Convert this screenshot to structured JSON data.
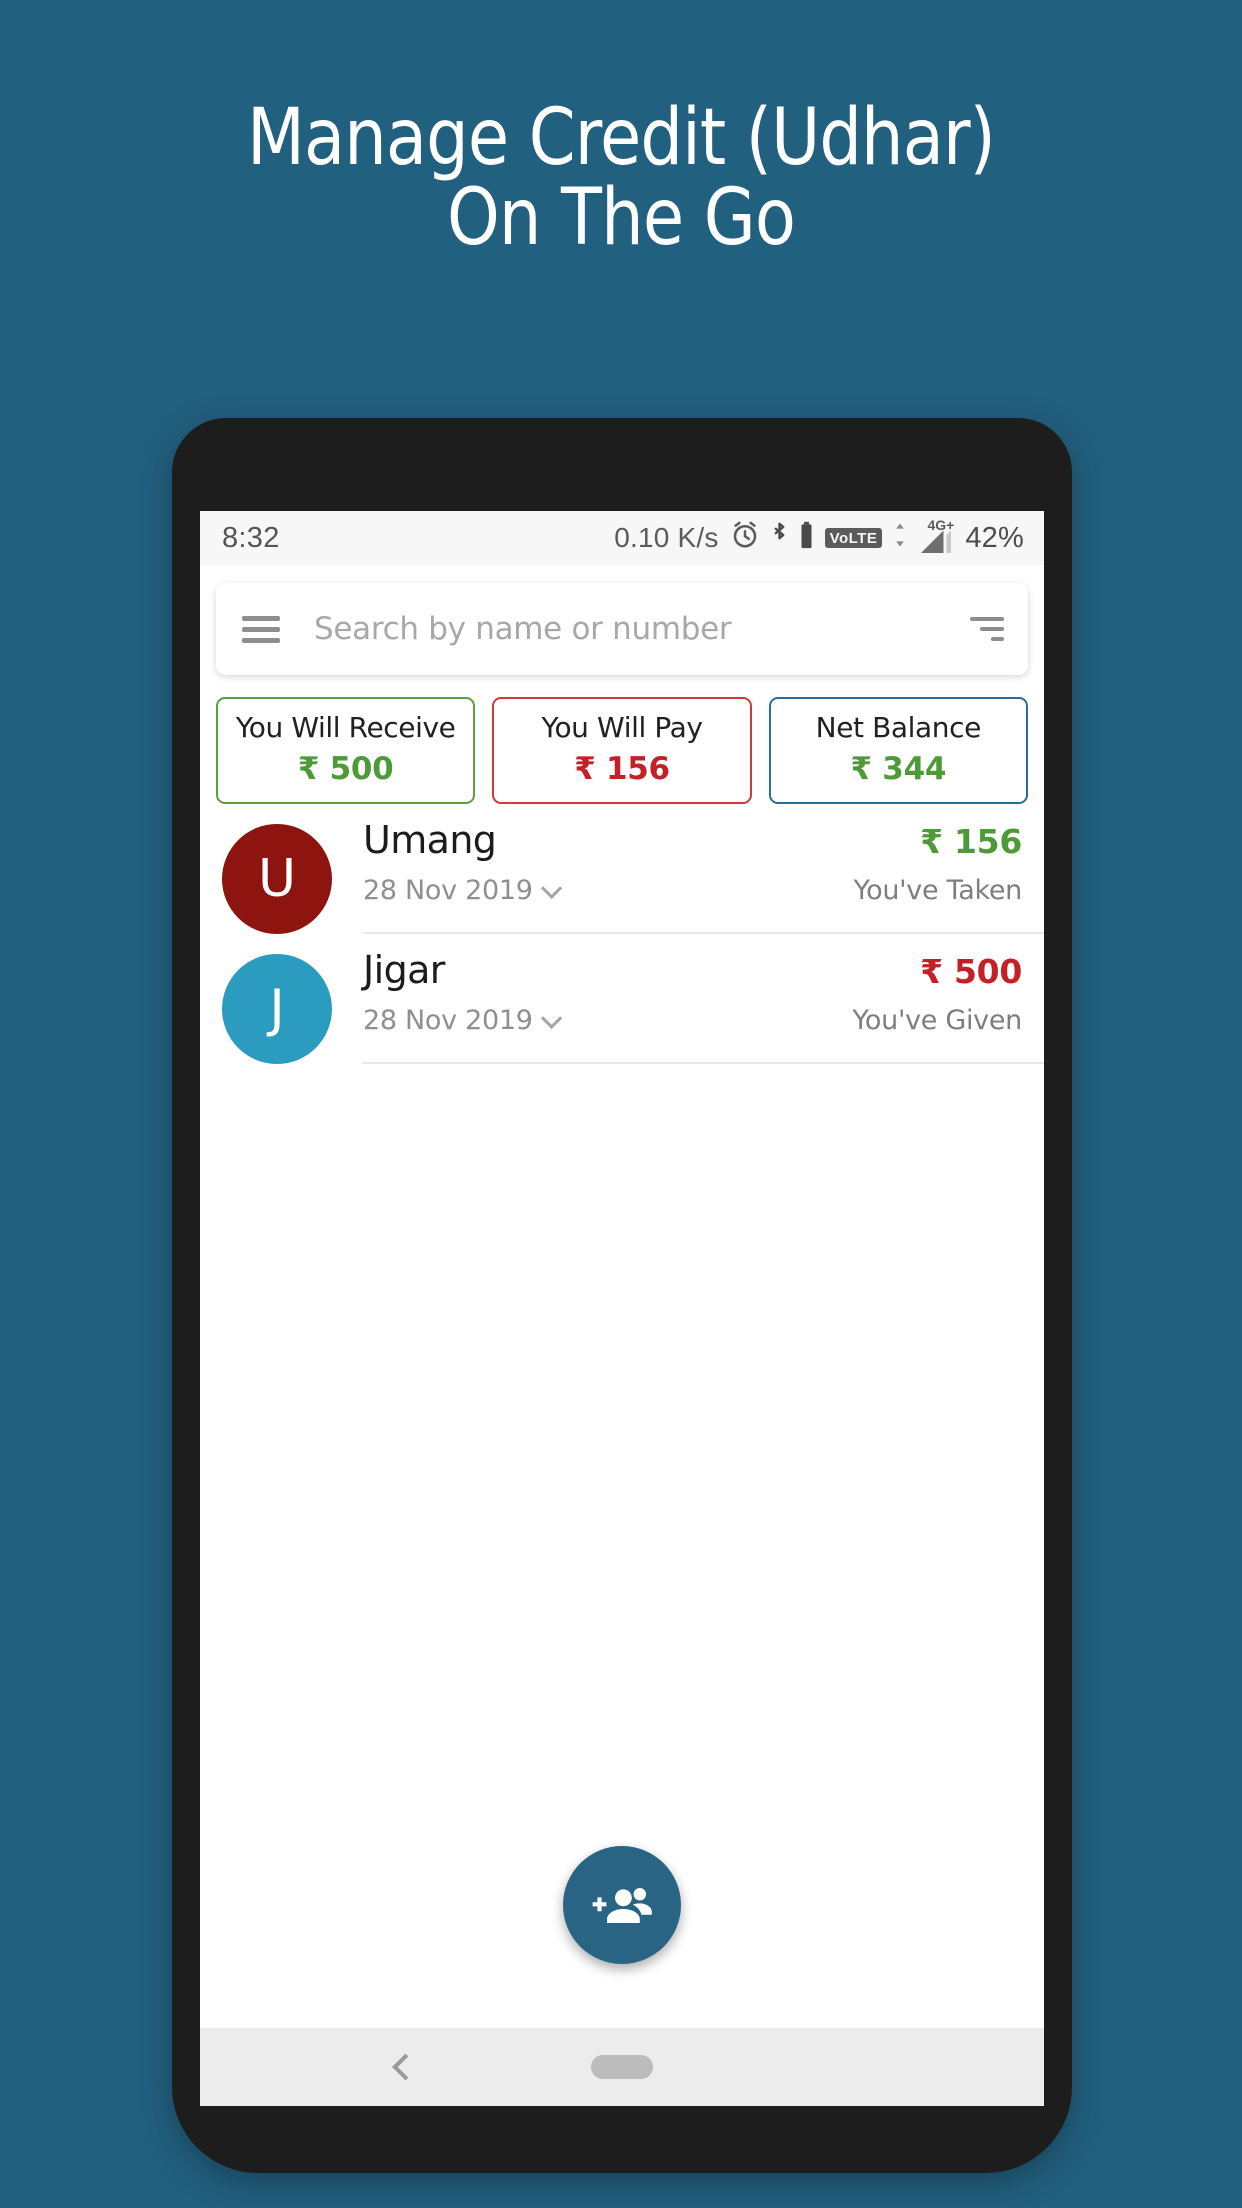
{
  "promo": {
    "headline": "Manage Credit (Udhar)\nOn The Go",
    "background_color": "#22607f"
  },
  "statusbar": {
    "time": "8:32",
    "network_speed": "0.10 K/s",
    "alarm_icon": "alarm-clock-icon",
    "bluetooth_icon": "bluetooth-icon",
    "battery_icon": "battery-icon",
    "volte_label": "VoLTE",
    "network_type": "4G+",
    "signal_icon": "signal-bars-icon",
    "battery_percent": "42%"
  },
  "search": {
    "placeholder": "Search by name or number",
    "menu_icon": "hamburger-menu-icon",
    "filter_icon": "filter-sort-icon"
  },
  "summary": {
    "chips": [
      {
        "label": "You Will Receive",
        "value": "₹ 500",
        "border_color": "#5aa03c",
        "value_color": "#4e9a38"
      },
      {
        "label": "You Will Pay",
        "value": "₹ 156",
        "border_color": "#cf3b3b",
        "value_color": "#c42026"
      },
      {
        "label": "Net Balance",
        "value": "₹ 344",
        "border_color": "#2b6d99",
        "value_color": "#4e9a38"
      }
    ]
  },
  "contacts": {
    "rows": [
      {
        "initial": "U",
        "avatar_color": "#8e1410",
        "name": "Umang",
        "date": "28 Nov 2019",
        "amount": "₹ 156",
        "amount_color": "#4e9a38",
        "status": "You've Taken"
      },
      {
        "initial": "J",
        "avatar_color": "#2b9cbf",
        "name": "Jigar",
        "date": "28 Nov 2019",
        "amount": "₹ 500",
        "amount_color": "#c42026",
        "status": "You've Given"
      }
    ]
  },
  "fab": {
    "icon": "add-people-icon",
    "color": "#2a6484"
  },
  "navbar": {
    "back_icon": "back-chevron-icon",
    "home_icon": "home-pill-icon"
  }
}
